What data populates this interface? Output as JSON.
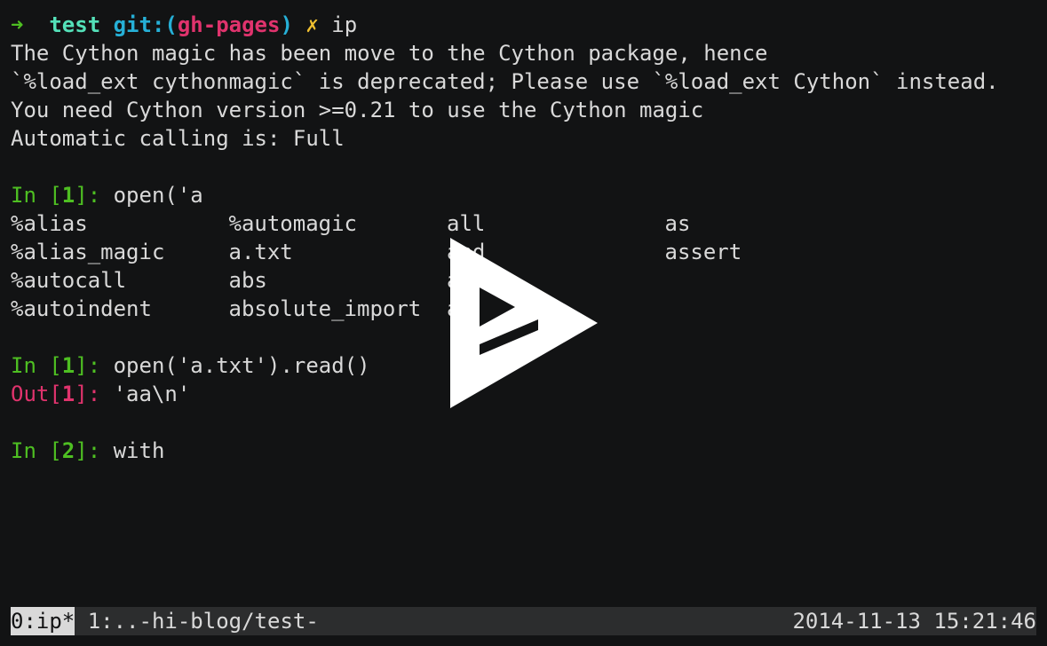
{
  "prompt": {
    "arrow": "➜",
    "dir": "test",
    "git_label": "git:",
    "paren_open": "(",
    "branch": "gh-pages",
    "paren_close": ")",
    "dirty": "✗",
    "command": "ip"
  },
  "messages": [
    "The Cython magic has been move to the Cython package, hence",
    "`%load_ext cythonmagic` is deprecated; Please use `%load_ext Cython` instead.",
    "You need Cython version >=0.21 to use the Cython magic",
    "Automatic calling is: Full"
  ],
  "in1": {
    "prefix": "In [",
    "num": "1",
    "suffix": "]: ",
    "code": "open('a"
  },
  "completions": [
    [
      "%alias",
      "%automagic",
      "all",
      "as"
    ],
    [
      "%alias_magic",
      "a.txt",
      "and",
      "assert"
    ],
    [
      "%autocall",
      "abs",
      "any",
      ""
    ],
    [
      "%autoindent",
      "absolute_import",
      "apply",
      ""
    ]
  ],
  "in1b": {
    "prefix": "In [",
    "num": "1",
    "suffix": "]: ",
    "code": "open('a.txt').read()"
  },
  "out1": {
    "prefix": "Out[",
    "num": "1",
    "suffix": "]: ",
    "value": "'aa\\n'"
  },
  "in2": {
    "prefix": "In [",
    "num": "2",
    "suffix": "]: ",
    "code": "with"
  },
  "tmux": {
    "active_window": "0:ip*",
    "other_window": " 1:..-hi-blog/test-",
    "clock": "2014-11-13 15:21:46"
  }
}
